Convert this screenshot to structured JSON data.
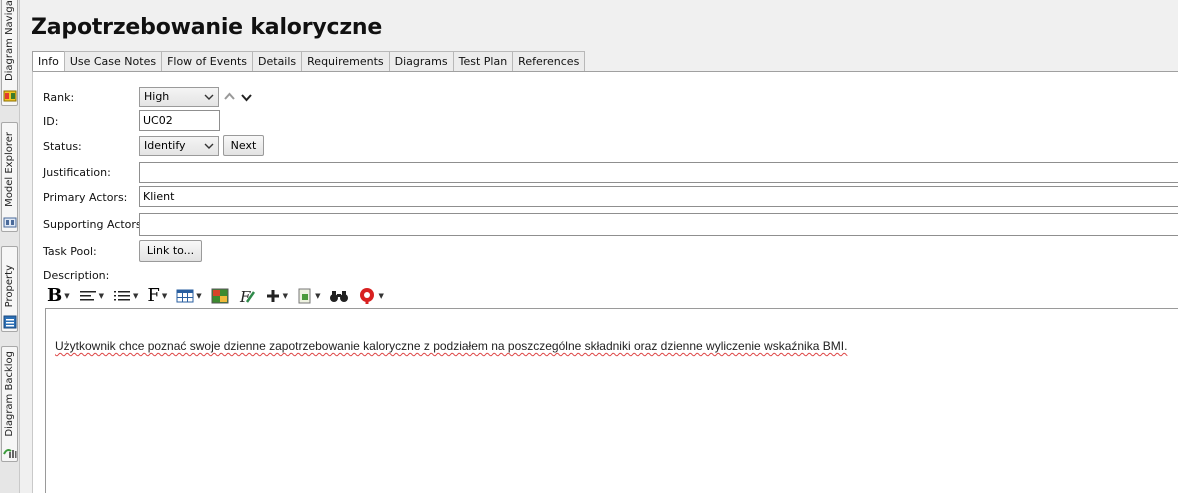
{
  "side_dock": {
    "tabs": [
      {
        "label": "Diagram Navigator",
        "icon": "diagram-navigator-icon"
      },
      {
        "label": "Model Explorer",
        "icon": "model-explorer-icon"
      },
      {
        "label": "Property",
        "icon": "property-icon"
      },
      {
        "label": "Diagram Backlog",
        "icon": "diagram-backlog-icon"
      }
    ]
  },
  "title": "Zapotrzebowanie kaloryczne",
  "tabs": [
    {
      "label": "Info",
      "active": true
    },
    {
      "label": "Use Case Notes"
    },
    {
      "label": "Flow of Events"
    },
    {
      "label": "Details"
    },
    {
      "label": "Requirements"
    },
    {
      "label": "Diagrams"
    },
    {
      "label": "Test Plan"
    },
    {
      "label": "References"
    }
  ],
  "form": {
    "rank_label": "Rank:",
    "rank_value": "High",
    "id_label": "ID:",
    "id_value": "UC02",
    "status_label": "Status:",
    "status_value": "Identify",
    "next_button": "Next",
    "justification_label": "Justification:",
    "justification_value": "",
    "primary_actors_label": "Primary Actors:",
    "primary_actors_value": "Klient",
    "supporting_actors_label": "Supporting Actors:",
    "supporting_actors_value": "",
    "task_pool_label": "Task Pool:",
    "link_button": "Link to...",
    "description_label": "Description:"
  },
  "toolbar": {
    "items": [
      "bold-icon",
      "align-icon",
      "list-icon",
      "font-icon",
      "table-icon",
      "image-icon",
      "format-painter-icon",
      "insert-icon",
      "attach-icon",
      "find-icon",
      "spellcheck-icon"
    ]
  },
  "description_text": "Użytkownik chce poznać swoje dzienne zapotrzebowanie kaloryczne z podziałem na poszczególne składniki oraz dzienne wyliczenie wskaźnika BMI."
}
